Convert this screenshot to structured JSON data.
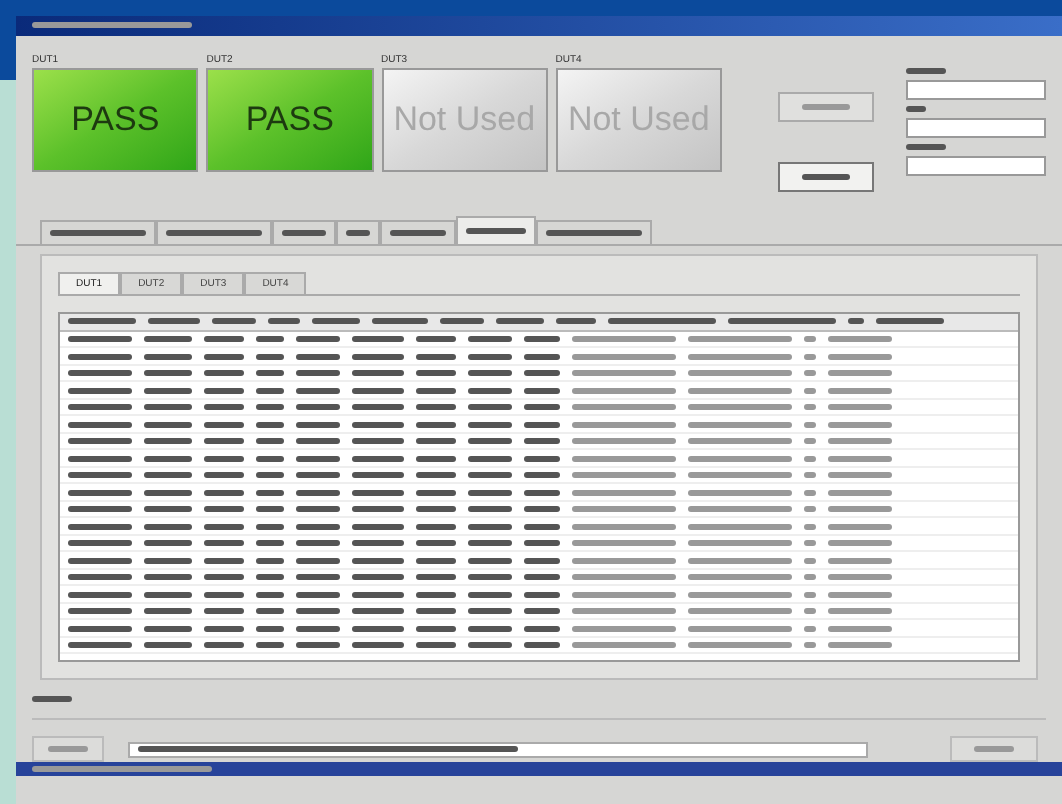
{
  "panels": [
    {
      "label": "DUT1",
      "result": "PASS",
      "kind": "pass"
    },
    {
      "label": "DUT2",
      "result": "PASS",
      "kind": "pass"
    },
    {
      "label": "DUT3",
      "result": "Not Used",
      "kind": "unused"
    },
    {
      "label": "DUT4",
      "result": "Not Used",
      "kind": "unused"
    }
  ],
  "main_tabs": [
    {
      "selected": false
    },
    {
      "selected": false
    },
    {
      "selected": false
    },
    {
      "selected": false
    },
    {
      "selected": false
    },
    {
      "selected": true
    },
    {
      "selected": false
    }
  ],
  "sub_tabs": [
    {
      "label": "DUT1",
      "selected": true
    },
    {
      "label": "DUT2",
      "selected": false
    },
    {
      "label": "DUT3",
      "selected": false
    },
    {
      "label": "DUT4",
      "selected": false
    }
  ]
}
